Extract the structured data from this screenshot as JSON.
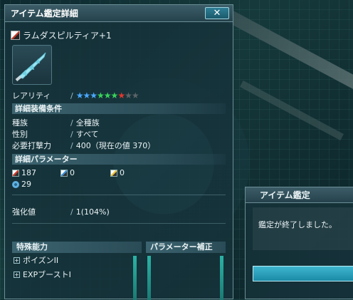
{
  "window": {
    "title": "アイテム鑑定詳細",
    "close_symbol": "✕"
  },
  "item": {
    "name": "ラムダスピルティア+1"
  },
  "rarity": {
    "label": "レアリティ",
    "stars_text": "★★★★★★★★★",
    "filled": 7,
    "total": 9
  },
  "equip": {
    "section": "詳細装備条件",
    "rows": [
      {
        "key": "種族",
        "value": "全種族"
      },
      {
        "key": "性別",
        "value": "すべて"
      },
      {
        "key": "必要打撃力",
        "value": "400（現在の値 370）"
      }
    ]
  },
  "params": {
    "section": "詳細パラメーター",
    "stats": [
      {
        "icon": "melee-attack-icon",
        "value": "187"
      },
      {
        "icon": "ranged-attack-icon",
        "value": "0"
      },
      {
        "icon": "tech-attack-icon",
        "value": "0"
      },
      {
        "icon": "dexterity-gear-icon",
        "value": "29"
      }
    ]
  },
  "grind": {
    "label": "強化値",
    "value": "1(104%)"
  },
  "abilities": {
    "section": "特殊能力",
    "items": [
      "ポイズンII",
      "EXPブーストI"
    ]
  },
  "param_bonus": {
    "section": "パラメーター補正"
  },
  "dialog": {
    "title": "アイテム鑑定",
    "message": "鑑定が終了しました。"
  },
  "colors": {
    "star_blue": "#4aa8ff",
    "star_green": "#39d25a",
    "star_red": "#e2372c",
    "star_empty": "#5b6468",
    "accent": "#2bb3a5"
  }
}
